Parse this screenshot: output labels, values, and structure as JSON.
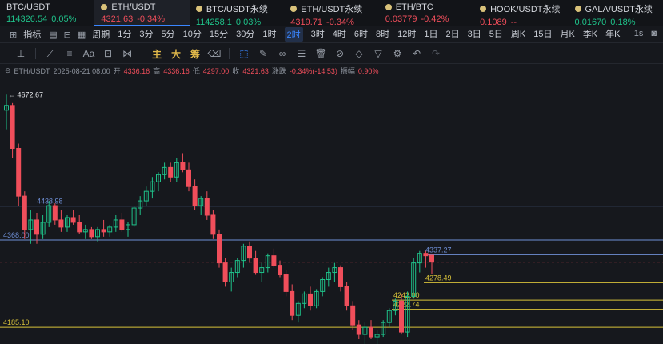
{
  "tickers": [
    {
      "symbol": "BTC/USDT",
      "price": "114326.54",
      "change": "0.05%",
      "dir": "up",
      "active": false,
      "dot": false
    },
    {
      "symbol": "ETH/USDT",
      "price": "4321.63",
      "change": "-0.34%",
      "dir": "down",
      "active": true,
      "dot": true
    },
    {
      "symbol": "BTC/USDT永续",
      "price": "114258.1",
      "change": "0.03%",
      "dir": "up",
      "active": false,
      "dot": true
    },
    {
      "symbol": "ETH/USDT永续",
      "price": "4319.71",
      "change": "-0.34%",
      "dir": "down",
      "active": false,
      "dot": true
    },
    {
      "symbol": "ETH/BTC",
      "price": "0.03779",
      "change": "-0.42%",
      "dir": "down",
      "active": false,
      "dot": true
    },
    {
      "symbol": "HOOK/USDT永续",
      "price": "0.1089",
      "change": "--",
      "dir": "down",
      "active": false,
      "dot": true
    },
    {
      "symbol": "GALA/USDT永续",
      "price": "0.01670",
      "change": "0.18%",
      "dir": "up",
      "active": false,
      "dot": true
    }
  ],
  "toolbar": {
    "indicator_label": "指标",
    "period_label": "周期",
    "intervals": [
      "1分",
      "3分",
      "5分",
      "10分",
      "15分",
      "30分",
      "1时",
      "2时",
      "3时",
      "4时",
      "6时",
      "8时",
      "12时",
      "1日",
      "2日",
      "3日",
      "5日",
      "周K",
      "15日",
      "月K",
      "季K",
      "年K"
    ],
    "selected_interval": "2时",
    "right": [
      "1s"
    ]
  },
  "drawing_tools": {
    "text_tool": "Aa",
    "gold_tools": [
      "主",
      "大",
      "筹"
    ]
  },
  "info": {
    "pair": "ETH/USDT",
    "datetime": "2025-08-21 08:00",
    "open_label": "开",
    "open": "4336.16",
    "high_label": "高",
    "high": "4336.16",
    "low_label": "低",
    "low": "4297.00",
    "close_label": "收",
    "close": "4321.63",
    "change_label": "涨跌",
    "change": "-0.34%(-14.53)",
    "amp_label": "振幅",
    "amp": "0.90%"
  },
  "chart_data": {
    "type": "candlestick",
    "price_range": [
      4150,
      4700
    ],
    "annotations": {
      "high_marker": "4672.67",
      "levels": [
        {
          "value": "4438.98",
          "color": "#6f8fd6"
        },
        {
          "value": "4368.00",
          "color": "#6f8fd6"
        },
        {
          "value": "4337.27",
          "color": "#6f8fd6"
        },
        {
          "value": "4278.49",
          "color": "#d8c23a"
        },
        {
          "value": "4242.00",
          "color": "#d8c23a"
        },
        {
          "value": "4222.74",
          "color": "#d8c23a"
        },
        {
          "value": "4185.10",
          "color": "#d8c23a"
        }
      ],
      "current_price_line": 4321.63
    },
    "colors": {
      "up": "#1fc28a",
      "down": "#f04e5b",
      "accent": "#3a86ff"
    },
    "candles": [
      [
        4640,
        4672.67,
        4600,
        4650
      ],
      [
        4650,
        4655,
        4540,
        4560
      ],
      [
        4560,
        4570,
        4440,
        4460
      ],
      [
        4460,
        4470,
        4370,
        4390
      ],
      [
        4390,
        4430,
        4360,
        4410
      ],
      [
        4410,
        4425,
        4360,
        4380
      ],
      [
        4380,
        4420,
        4370,
        4405
      ],
      [
        4405,
        4450,
        4395,
        4440
      ],
      [
        4440,
        4445,
        4400,
        4410
      ],
      [
        4410,
        4430,
        4385,
        4395
      ],
      [
        4395,
        4420,
        4385,
        4415
      ],
      [
        4415,
        4430,
        4400,
        4405
      ],
      [
        4405,
        4420,
        4380,
        4385
      ],
      [
        4385,
        4400,
        4370,
        4390
      ],
      [
        4390,
        4395,
        4370,
        4375
      ],
      [
        4375,
        4395,
        4365,
        4390
      ],
      [
        4390,
        4410,
        4375,
        4385
      ],
      [
        4385,
        4400,
        4375,
        4395
      ],
      [
        4395,
        4420,
        4385,
        4410
      ],
      [
        4410,
        4425,
        4385,
        4390
      ],
      [
        4390,
        4405,
        4375,
        4400
      ],
      [
        4400,
        4440,
        4395,
        4435
      ],
      [
        4435,
        4460,
        4420,
        4450
      ],
      [
        4450,
        4480,
        4440,
        4470
      ],
      [
        4470,
        4500,
        4455,
        4490
      ],
      [
        4490,
        4510,
        4470,
        4505
      ],
      [
        4505,
        4530,
        4495,
        4520
      ],
      [
        4520,
        4530,
        4490,
        4500
      ],
      [
        4500,
        4540,
        4490,
        4530
      ],
      [
        4530,
        4550,
        4510,
        4515
      ],
      [
        4515,
        4530,
        4470,
        4480
      ],
      [
        4480,
        4495,
        4430,
        4440
      ],
      [
        4440,
        4460,
        4420,
        4455
      ],
      [
        4455,
        4470,
        4410,
        4420
      ],
      [
        4420,
        4430,
        4370,
        4380
      ],
      [
        4380,
        4390,
        4310,
        4320
      ],
      [
        4320,
        4330,
        4270,
        4280
      ],
      [
        4280,
        4310,
        4260,
        4300
      ],
      [
        4300,
        4330,
        4290,
        4325
      ],
      [
        4325,
        4360,
        4310,
        4355
      ],
      [
        4355,
        4365,
        4320,
        4330
      ],
      [
        4330,
        4345,
        4295,
        4300
      ],
      [
        4300,
        4320,
        4280,
        4310
      ],
      [
        4310,
        4340,
        4300,
        4335
      ],
      [
        4335,
        4350,
        4310,
        4315
      ],
      [
        4315,
        4325,
        4290,
        4295
      ],
      [
        4295,
        4305,
        4250,
        4260
      ],
      [
        4260,
        4275,
        4200,
        4210
      ],
      [
        4210,
        4240,
        4195,
        4235
      ],
      [
        4235,
        4260,
        4225,
        4255
      ],
      [
        4255,
        4270,
        4220,
        4230
      ],
      [
        4230,
        4265,
        4225,
        4260
      ],
      [
        4260,
        4290,
        4250,
        4285
      ],
      [
        4285,
        4310,
        4270,
        4300
      ],
      [
        4300,
        4320,
        4280,
        4310
      ],
      [
        4310,
        4315,
        4260,
        4270
      ],
      [
        4270,
        4280,
        4220,
        4230
      ],
      [
        4230,
        4240,
        4180,
        4190
      ],
      [
        4190,
        4200,
        4160,
        4170
      ],
      [
        4170,
        4195,
        4150,
        4185
      ],
      [
        4185,
        4200,
        4160,
        4165
      ],
      [
        4165,
        4180,
        4150,
        4170
      ],
      [
        4170,
        4200,
        4165,
        4195
      ],
      [
        4195,
        4225,
        4185,
        4220
      ],
      [
        4220,
        4245,
        4210,
        4240
      ],
      [
        4240,
        4255,
        4170,
        4175
      ],
      [
        4175,
        4260,
        4165,
        4250
      ],
      [
        4250,
        4330,
        4245,
        4320
      ],
      [
        4320,
        4345,
        4300,
        4340
      ],
      [
        4340,
        4345,
        4310,
        4335
      ],
      [
        4336.16,
        4336.16,
        4297,
        4321.63
      ]
    ]
  }
}
